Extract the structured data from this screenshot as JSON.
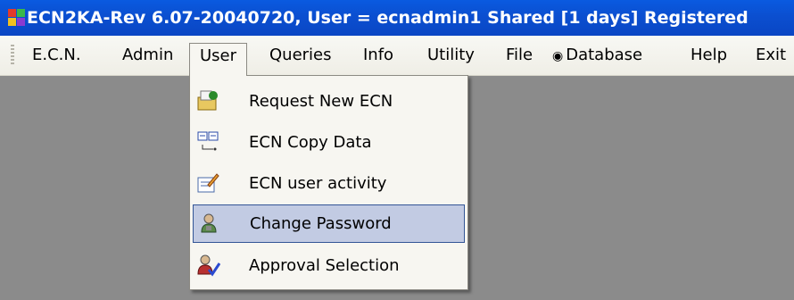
{
  "window": {
    "title": "ECN2KA-Rev 6.07-20040720, User = ecnadmin1 Shared [1 days] Registered",
    "icon": "app-icon"
  },
  "menubar": {
    "items": [
      {
        "label": "E.C.N."
      },
      {
        "label": "Admin"
      },
      {
        "label": "User",
        "active": true
      },
      {
        "label": "Queries"
      },
      {
        "label": "Info"
      },
      {
        "label": "Utility"
      },
      {
        "label": "File"
      },
      {
        "label": "Database",
        "icon": "eye-icon"
      },
      {
        "label": "Help"
      },
      {
        "label": "Exit"
      }
    ]
  },
  "dropdown": {
    "items": [
      {
        "label": "Request New ECN",
        "icon": "request-ecn-icon"
      },
      {
        "label": "ECN Copy Data",
        "icon": "copy-data-icon"
      },
      {
        "label": "ECN user activity",
        "icon": "edit-activity-icon"
      },
      {
        "label": "Change Password",
        "icon": "user-password-icon",
        "highlighted": true
      },
      {
        "label": "Approval Selection",
        "icon": "user-approve-icon"
      }
    ]
  },
  "colors": {
    "titlebar": "#0a4fd0",
    "menubar": "#f2f1ea",
    "workspace": "#8b8b8b",
    "highlight_fill": "#c2cbe3",
    "highlight_border": "#325596"
  },
  "glyphs": {
    "eye": "◉"
  }
}
